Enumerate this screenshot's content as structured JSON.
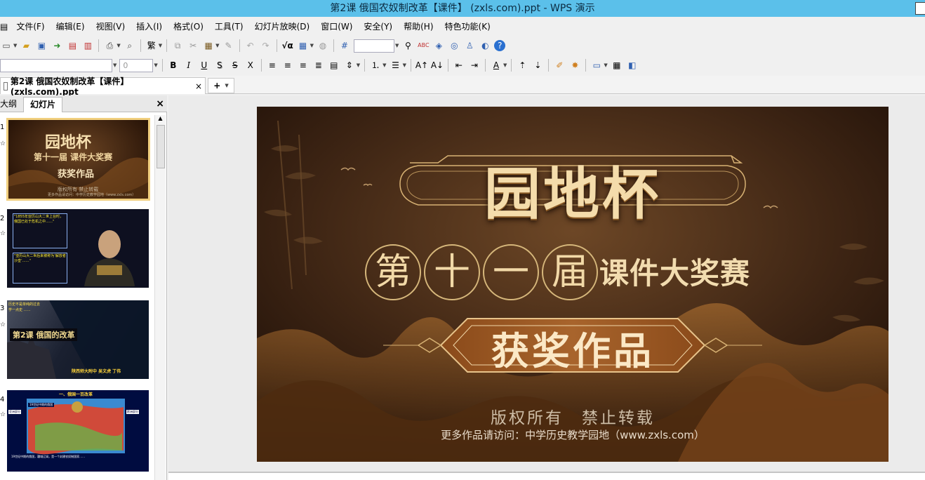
{
  "window": {
    "title": "第2课 俄国农奴制改革【课件】 (zxls.com).ppt - WPS 演示"
  },
  "menu": [
    "文件(F)",
    "编辑(E)",
    "视图(V)",
    "插入(I)",
    "格式(O)",
    "工具(T)",
    "幻灯片放映(D)",
    "窗口(W)",
    "安全(Y)",
    "帮助(H)",
    "特色功能(K)"
  ],
  "format_toolbar": {
    "font_size": "0",
    "bold": "B",
    "italic": "I",
    "underline": "U",
    "shadow": "S",
    "strike": "S",
    "subscript": "X"
  },
  "document_tab": {
    "label": "第2课 俄国农奴制改革【课件】 (zxls.com).ppt",
    "close": "×",
    "add": "+"
  },
  "left_pane": {
    "tabs": [
      "大纲",
      "幻灯片"
    ],
    "close": "×",
    "thumbnails": [
      {
        "number": "1",
        "star": "☆",
        "title": "园地杯",
        "line2": "第十一届 课件大奖赛",
        "line3": "获奖作品",
        "line4": "版权所有   禁止转载",
        "line5": "更多作品请访问：中学历史教学园地（www.zxls.com）"
      },
      {
        "number": "2",
        "star": "☆",
        "text1": "\"1855年亚历山大二世上台时，俄国已处于危机之中……\"",
        "text2": "\"亚历山大二世后来被称为‘解放者沙皇’……\""
      },
      {
        "number": "3",
        "star": "☆",
        "banner": "第2课 俄国的改革",
        "credit": "陕西师大附中 吴文虎  丁伟",
        "top1": "历史不是单纯的过去",
        "top2": "学一点史 ……"
      },
      {
        "number": "4",
        "star": "☆",
        "heading": "一、俄国一百改革",
        "left_label": "亚洲部分",
        "right_label": "欧洲部分",
        "map_title": "19世纪中期的俄国",
        "caption": "19世纪中期的俄国，疆域辽阔，是一个封建农奴制国家……"
      }
    ]
  },
  "slide": {
    "title": "园地杯",
    "ordinal_chars": [
      "第",
      "十",
      "一",
      "届"
    ],
    "subtitle": "课件大奖赛",
    "award": "获奖作品",
    "copyright": "版权所有　禁止转载",
    "more": "更多作品请访问：中学历史教学园地（www.zxls.com）"
  },
  "colors": {
    "titlebar": "#5bc0ea",
    "slide_bg": "#3a2212",
    "gold": "#f4dcab"
  }
}
